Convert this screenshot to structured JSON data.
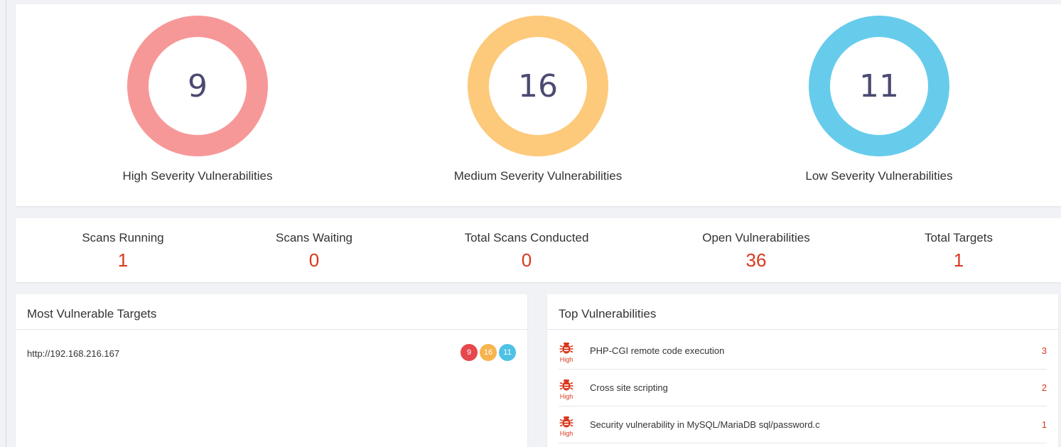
{
  "severity": {
    "high": {
      "count": "9",
      "label": "High Severity Vulnerabilities",
      "color": "#f79898"
    },
    "medium": {
      "count": "16",
      "label": "Medium Severity Vulnerabilities",
      "color": "#fdc97b"
    },
    "low": {
      "count": "11",
      "label": "Low Severity Vulnerabilities",
      "color": "#67ccec"
    }
  },
  "stats": [
    {
      "label": "Scans Running",
      "value": "1"
    },
    {
      "label": "Scans Waiting",
      "value": "0"
    },
    {
      "label": "Total Scans Conducted",
      "value": "0"
    },
    {
      "label": "Open Vulnerabilities",
      "value": "36"
    },
    {
      "label": "Total Targets",
      "value": "1"
    }
  ],
  "targets_panel": {
    "title": "Most Vulnerable Targets",
    "rows": [
      {
        "url": "http://192.168.216.167",
        "high": "9",
        "medium": "16",
        "low": "11"
      }
    ]
  },
  "top_vulns_panel": {
    "title": "Top Vulnerabilities",
    "rows": [
      {
        "severity": "High",
        "icon": "bug-icon",
        "name": "PHP-CGI remote code execution",
        "count": "3"
      },
      {
        "severity": "High",
        "icon": "bug-icon",
        "name": "Cross site scripting",
        "count": "2"
      },
      {
        "severity": "High",
        "icon": "bug-icon",
        "name": "Security vulnerability in MySQL/MariaDB sql/password.c",
        "count": "1"
      }
    ]
  },
  "colors": {
    "high": "#e5484d",
    "medium": "#f7b34d",
    "low": "#4ec2e6",
    "accent": "#d9381e"
  }
}
